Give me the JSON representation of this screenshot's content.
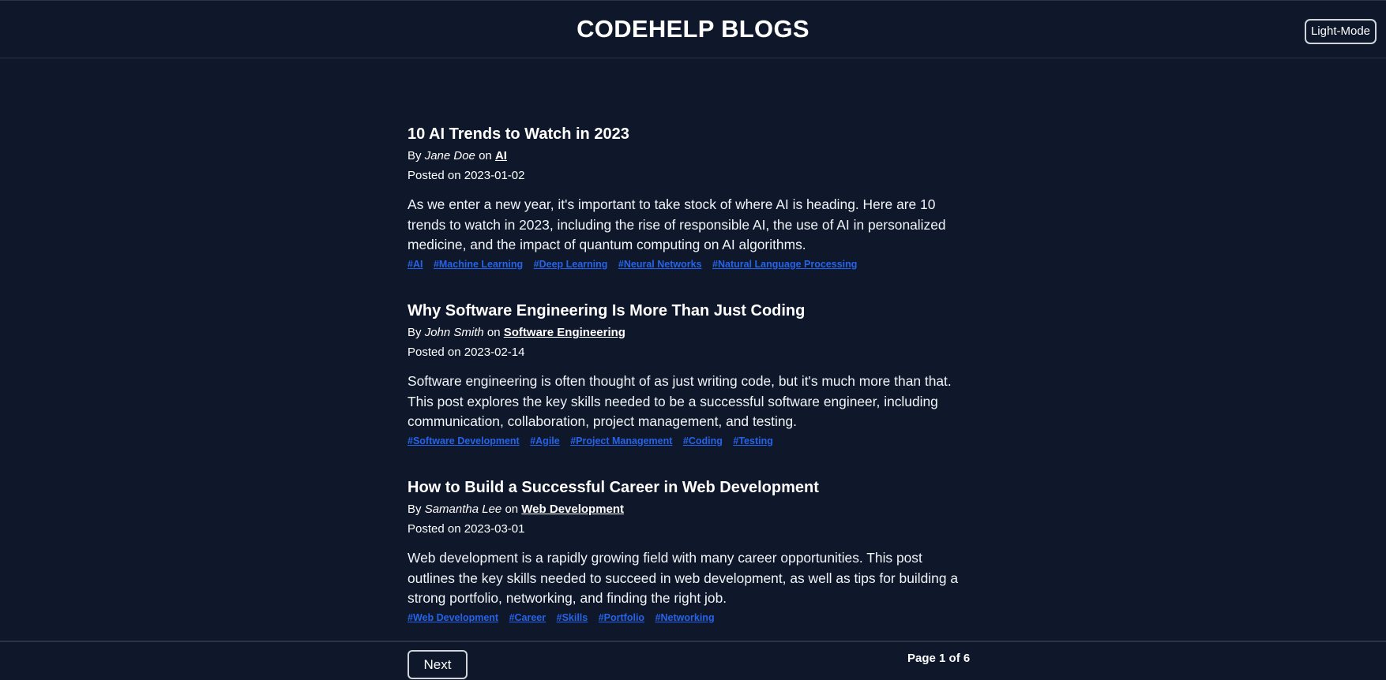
{
  "header": {
    "title": "CODEHELP BLOGS",
    "mode_toggle_label": "Light-Mode"
  },
  "posts": [
    {
      "title": "10 AI Trends to Watch in 2023",
      "by_label": "By",
      "author": "Jane Doe",
      "on_label": "on",
      "category": "AI",
      "posted_label": "Posted on",
      "date": "2023-01-02",
      "content": "As we enter a new year, it's important to take stock of where AI is heading. Here are 10 trends to watch in 2023, including the rise of responsible AI, the use of AI in personalized medicine, and the impact of quantum computing on AI algorithms.",
      "tags": [
        "#AI",
        "#Machine Learning",
        "#Deep Learning",
        "#Neural Networks",
        "#Natural Language Processing"
      ]
    },
    {
      "title": "Why Software Engineering Is More Than Just Coding",
      "by_label": "By",
      "author": "John Smith",
      "on_label": "on",
      "category": "Software Engineering",
      "posted_label": "Posted on",
      "date": "2023-02-14",
      "content": "Software engineering is often thought of as just writing code, but it's much more than that. This post explores the key skills needed to be a successful software engineer, including communication, collaboration, project management, and testing.",
      "tags": [
        "#Software Development",
        "#Agile",
        "#Project Management",
        "#Coding",
        "#Testing"
      ]
    },
    {
      "title": "How to Build a Successful Career in Web Development",
      "by_label": "By",
      "author": "Samantha Lee",
      "on_label": "on",
      "category": "Web Development",
      "posted_label": "Posted on",
      "date": "2023-03-01",
      "content": "Web development is a rapidly growing field with many career opportunities. This post outlines the key skills needed to succeed in web development, as well as tips for building a strong portfolio, networking, and finding the right job.",
      "tags": [
        "#Web Development",
        "#Career",
        "#Skills",
        "#Portfolio",
        "#Networking"
      ]
    }
  ],
  "footer": {
    "next_label": "Next",
    "page_indicator": "Page 1 of 6"
  },
  "colors": {
    "background": "#0f172a",
    "tag_link": "#2563eb",
    "border": "#2b3445"
  }
}
